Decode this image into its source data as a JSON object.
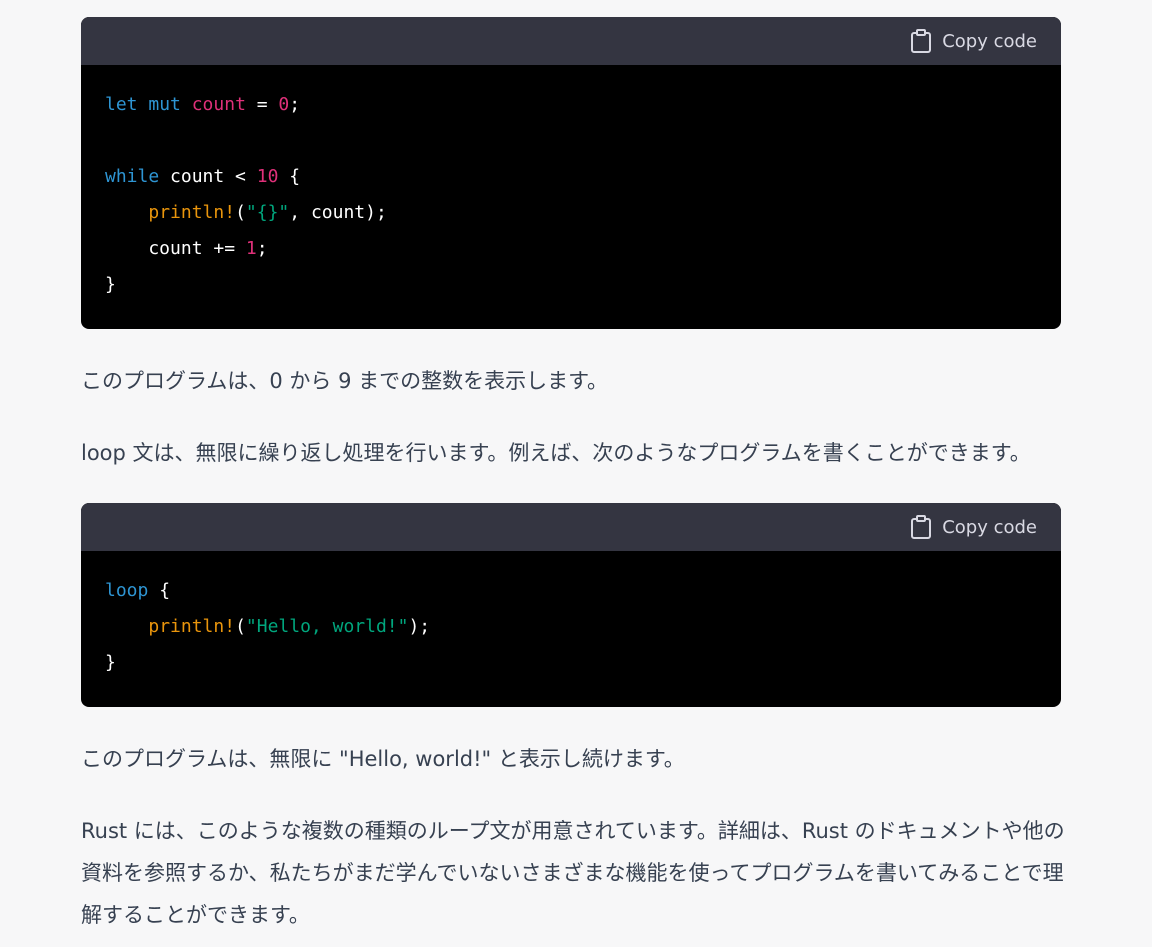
{
  "code_blocks": [
    {
      "copy_label": "Copy code",
      "lines": [
        [
          {
            "t": "let",
            "c": "kw"
          },
          {
            "t": " ",
            "c": "plain"
          },
          {
            "t": "mut",
            "c": "kw"
          },
          {
            "t": " ",
            "c": "plain"
          },
          {
            "t": "count",
            "c": "var"
          },
          {
            "t": " = ",
            "c": "plain"
          },
          {
            "t": "0",
            "c": "num"
          },
          {
            "t": ";",
            "c": "plain"
          }
        ],
        [],
        [
          {
            "t": "while",
            "c": "kw"
          },
          {
            "t": " count < ",
            "c": "plain"
          },
          {
            "t": "10",
            "c": "num"
          },
          {
            "t": " {",
            "c": "plain"
          }
        ],
        [
          {
            "t": "    ",
            "c": "plain"
          },
          {
            "t": "println!",
            "c": "mac2"
          },
          {
            "t": "(",
            "c": "plain"
          },
          {
            "t": "\"{}\"",
            "c": "str"
          },
          {
            "t": ", count);",
            "c": "plain"
          }
        ],
        [
          {
            "t": "    count += ",
            "c": "plain"
          },
          {
            "t": "1",
            "c": "num"
          },
          {
            "t": ";",
            "c": "plain"
          }
        ],
        [
          {
            "t": "}",
            "c": "plain"
          }
        ]
      ]
    },
    {
      "copy_label": "Copy code",
      "lines": [
        [
          {
            "t": "loop",
            "c": "kw"
          },
          {
            "t": " {",
            "c": "plain"
          }
        ],
        [
          {
            "t": "    ",
            "c": "plain"
          },
          {
            "t": "println!",
            "c": "mac2"
          },
          {
            "t": "(",
            "c": "plain"
          },
          {
            "t": "\"Hello, world!\"",
            "c": "str"
          },
          {
            "t": ");",
            "c": "plain"
          }
        ],
        [
          {
            "t": "}",
            "c": "plain"
          }
        ]
      ]
    }
  ],
  "paragraphs": {
    "p1": "このプログラムは、0 から 9 までの整数を表示します。",
    "p2": "loop 文は、無限に繰り返し処理を行います。例えば、次のようなプログラムを書くことができます。",
    "p3": "このプログラムは、無限に \"Hello, world!\" と表示し続けます。",
    "p4": "Rust には、このような複数の種類のループ文が用意されています。詳細は、Rust のドキュメントや他の資料を参照するか、私たちがまだ学んでいないさまざまな機能を使ってプログラムを書いてみることで理解することができます。"
  },
  "colors": {
    "page_bg": "#f7f7f8",
    "code_header_bg": "#343541",
    "code_bg": "#000000",
    "keyword": "#2e95d3",
    "variable": "#df3079",
    "macro": "#e9950c",
    "string": "#00a67d"
  }
}
